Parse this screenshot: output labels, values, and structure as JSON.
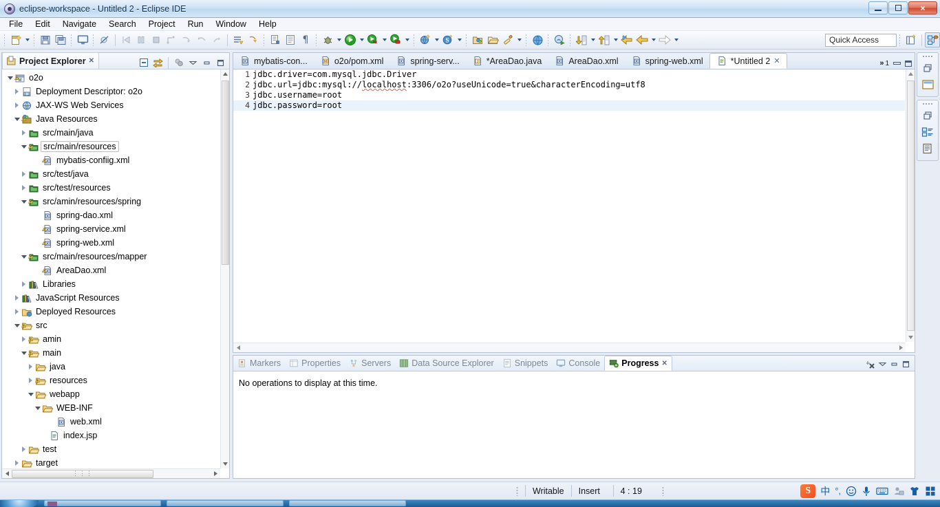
{
  "window": {
    "title": "eclipse-workspace - Untitled 2 - Eclipse IDE",
    "app_icon": "eclipse-icon",
    "controls": {
      "minimize": "minimize-button",
      "restore": "restore-button",
      "close": "×"
    }
  },
  "menubar": {
    "items": [
      "File",
      "Edit",
      "Navigate",
      "Search",
      "Project",
      "Run",
      "Window",
      "Help"
    ]
  },
  "toolbar": {
    "quick_access_placeholder": "Quick Access",
    "buttons": [
      "new-wizard-icon",
      "new-dropdown-arrow",
      "save-icon",
      "save-all-icon",
      "print-screen-icon",
      "toggle-breakpoint-icon",
      "step-into-icon",
      "step-over-icon",
      "terminate-icon",
      "skip-breakpoints-icon",
      "step-return-icon",
      "resume-icon",
      "relaunch-icon",
      "open-task-icon",
      "next-annotation-icon",
      "new-java-class-icon",
      "new-java-package-icon",
      "show-whitespace-icon",
      "debug-icon",
      "debug-dropdown-arrow",
      "run-icon",
      "run-dropdown-arrow",
      "run-server-icon",
      "run-server-dropdown-arrow",
      "profile-icon",
      "profile-dropdown-arrow",
      "new-web-project-icon",
      "web-dropdown-arrow",
      "new-spring-icon",
      "spring-dropdown-arrow",
      "open-type-icon",
      "open-resource-icon",
      "search-icon",
      "search-dropdown-arrow",
      "open-web-browser-icon",
      "open-perspective-icon",
      "next-edit-icon",
      "next-edit-dropdown-arrow",
      "previous-edit-icon",
      "previous-edit-dropdown-arrow",
      "back-icon",
      "forward-icon",
      "forward-dropdown-arrow",
      "next-icon",
      "next-dropdown-arrow"
    ],
    "perspective": {
      "open_perspective": "open-perspective-icon",
      "current": "java-ee-perspective-icon"
    }
  },
  "project_explorer": {
    "title": "Project Explorer",
    "close_glyph": "✕",
    "tools": [
      "collapse-all-icon",
      "link-with-editor-icon",
      "view-menu-icon",
      "minimize-icon",
      "maximize-icon"
    ],
    "tree": [
      {
        "label": "o2o",
        "indent": 0,
        "twisty": "open",
        "icon": "maven-project-icon",
        "selected": false
      },
      {
        "label": "Deployment Descriptor: o2o",
        "indent": 1,
        "twisty": "closed",
        "icon": "deployment-descriptor-icon",
        "selected": false
      },
      {
        "label": "JAX-WS Web Services",
        "indent": 1,
        "twisty": "closed",
        "icon": "jaxws-icon",
        "selected": false
      },
      {
        "label": "Java Resources",
        "indent": 1,
        "twisty": "open",
        "icon": "java-resources-icon",
        "selected": false
      },
      {
        "label": "src/main/java",
        "indent": 2,
        "twisty": "closed",
        "icon": "source-folder-icon",
        "selected": false
      },
      {
        "label": "src/main/resources",
        "indent": 2,
        "twisty": "open",
        "icon": "source-folder-warning-icon",
        "selected": true
      },
      {
        "label": "mybatis-confiig.xml",
        "indent": 4,
        "twisty": "none",
        "icon": "xml-file-warning-icon",
        "selected": false
      },
      {
        "label": "src/test/java",
        "indent": 2,
        "twisty": "closed",
        "icon": "source-folder-icon",
        "selected": false
      },
      {
        "label": "src/test/resources",
        "indent": 2,
        "twisty": "closed",
        "icon": "source-folder-icon",
        "selected": false
      },
      {
        "label": "src/amin/resources/spring",
        "indent": 2,
        "twisty": "open",
        "icon": "source-folder-warning-icon",
        "selected": false
      },
      {
        "label": "spring-dao.xml",
        "indent": 4,
        "twisty": "none",
        "icon": "xml-file-icon",
        "selected": false
      },
      {
        "label": "spring-service.xml",
        "indent": 4,
        "twisty": "none",
        "icon": "xml-file-warning-icon",
        "selected": false
      },
      {
        "label": "spring-web.xml",
        "indent": 4,
        "twisty": "none",
        "icon": "xml-file-warning-icon",
        "selected": false
      },
      {
        "label": "src/main/resources/mapper",
        "indent": 2,
        "twisty": "open",
        "icon": "source-folder-warning-icon",
        "selected": false
      },
      {
        "label": "AreaDao.xml",
        "indent": 4,
        "twisty": "none",
        "icon": "xml-file-warning-icon",
        "selected": false
      },
      {
        "label": "Libraries",
        "indent": 2,
        "twisty": "closed",
        "icon": "libraries-icon",
        "selected": false
      },
      {
        "label": "JavaScript Resources",
        "indent": 1,
        "twisty": "closed",
        "icon": "libraries-icon",
        "selected": false
      },
      {
        "label": "Deployed Resources",
        "indent": 1,
        "twisty": "closed",
        "icon": "deployed-resources-icon",
        "selected": false
      },
      {
        "label": "src",
        "indent": 1,
        "twisty": "open",
        "icon": "folder-warning-icon",
        "selected": false
      },
      {
        "label": "amin",
        "indent": 2,
        "twisty": "closed",
        "icon": "folder-warning-icon",
        "selected": false
      },
      {
        "label": "main",
        "indent": 2,
        "twisty": "open",
        "icon": "folder-warning-icon",
        "selected": false
      },
      {
        "label": "java",
        "indent": 3,
        "twisty": "closed",
        "icon": "folder-icon",
        "selected": false
      },
      {
        "label": "resources",
        "indent": 3,
        "twisty": "closed",
        "icon": "folder-warning-icon",
        "selected": false
      },
      {
        "label": "webapp",
        "indent": 3,
        "twisty": "open",
        "icon": "folder-icon",
        "selected": false
      },
      {
        "label": "WEB-INF",
        "indent": 4,
        "twisty": "open",
        "icon": "folder-icon",
        "selected": false
      },
      {
        "label": "web.xml",
        "indent": 6,
        "twisty": "none",
        "icon": "xml-file-icon",
        "selected": false
      },
      {
        "label": "index.jsp",
        "indent": 5,
        "twisty": "none",
        "icon": "jsp-file-icon",
        "selected": false
      },
      {
        "label": "test",
        "indent": 2,
        "twisty": "closed",
        "icon": "folder-icon",
        "selected": false
      },
      {
        "label": "target",
        "indent": 1,
        "twisty": "closed",
        "icon": "folder-icon",
        "selected": false
      }
    ],
    "hscroll_grip": "⋮⋮⋮"
  },
  "editor": {
    "tabs": [
      {
        "label": "mybatis-con...",
        "icon": "xml-file-icon",
        "active": false,
        "dirty": false
      },
      {
        "label": "o2o/pom.xml",
        "icon": "maven-file-icon",
        "active": false,
        "dirty": false
      },
      {
        "label": "spring-serv...",
        "icon": "xml-file-icon",
        "active": false,
        "dirty": false
      },
      {
        "label": "*AreaDao.java",
        "icon": "java-file-icon",
        "active": false,
        "dirty": true
      },
      {
        "label": "AreaDao.xml",
        "icon": "xml-file-icon",
        "active": false,
        "dirty": false
      },
      {
        "label": "spring-web.xml",
        "icon": "xml-file-icon",
        "active": false,
        "dirty": false
      },
      {
        "label": "*Untitled 2",
        "icon": "text-file-icon",
        "active": true,
        "dirty": true
      }
    ],
    "active_close_glyph": "✕",
    "overflow_chevron": "»",
    "overflow_count": "1",
    "lines": [
      {
        "no": "1",
        "text": "jdbc.driver=com.mysql.jdbc.Driver",
        "highlight": false
      },
      {
        "no": "2",
        "text": "jdbc.url=jdbc:mysql://localhost:3306/o2o?useUnicode=true&characterEncoding=utf8",
        "highlight": false,
        "squiggle_word": "localhost"
      },
      {
        "no": "3",
        "text": "jdbc.username=root",
        "highlight": false
      },
      {
        "no": "4",
        "text": "jdbc.password=root",
        "highlight": true
      }
    ]
  },
  "bottom_view": {
    "tabs": [
      {
        "label": "Markers",
        "icon": "markers-icon",
        "active": false
      },
      {
        "label": "Properties",
        "icon": "properties-icon",
        "active": false
      },
      {
        "label": "Servers",
        "icon": "servers-icon",
        "active": false
      },
      {
        "label": "Data Source Explorer",
        "icon": "datasource-icon",
        "active": false
      },
      {
        "label": "Snippets",
        "icon": "snippets-icon",
        "active": false
      },
      {
        "label": "Console",
        "icon": "console-icon",
        "active": false
      },
      {
        "label": "Progress",
        "icon": "progress-icon",
        "active": true
      }
    ],
    "active_close_glyph": "✕",
    "tools": [
      "cancel-all-icon",
      "view-menu-icon",
      "minimize-icon",
      "maximize-icon"
    ],
    "message": "No operations to display at this time."
  },
  "fast_view": {
    "groups": [
      {
        "icons": [
          "restore-icon",
          "outline-icon"
        ]
      },
      {
        "icons": [
          "restore-icon",
          "task-list-icon",
          "properties-view-icon"
        ]
      }
    ]
  },
  "status_bar": {
    "writable": "Writable",
    "insert_mode": "Insert",
    "cursor_position": "4 : 19",
    "tray_icons": [
      "sogou-logo-icon",
      "chinese-mode-icon",
      "punctuation-icon",
      "emoji-icon",
      "voice-icon",
      "keyboard-icon",
      "user-icon",
      "skin-icon",
      "toolbox-icon"
    ],
    "tray_labels": {
      "sogou": "S",
      "chinese": "中",
      "punct": "°,",
      "emoji": "☺",
      "voice": "🎤",
      "keyboard": "⌨",
      "user": "👤",
      "skin": "👕",
      "tools": "▦"
    }
  },
  "colors": {
    "accent_blue": "#1560a8",
    "title_gradient_top": "#eaf3fc",
    "selection_row": "#eaf2fb",
    "warning_orange": "#e8a33d",
    "xml_icon_blue": "#4a6fa5",
    "desktop_blue": "#1e5d96"
  }
}
